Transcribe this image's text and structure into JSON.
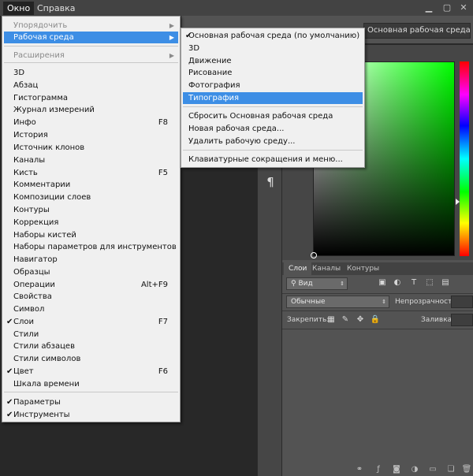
{
  "menubar": {
    "items": [
      "Окно",
      "Справка"
    ]
  },
  "options_bar": {
    "workspace_select": "Основная рабочая среда"
  },
  "dock": {
    "paragraph_glyph": "¶"
  },
  "layers_panel": {
    "tabs": [
      "Слои",
      "Каналы",
      "Контуры"
    ],
    "filter_label": "Вид",
    "blend_mode": "Обычные",
    "opacity_label": "Непрозрачность:",
    "lock_label": "Закрепить:",
    "fill_label": "Заливка:"
  },
  "window_menu": {
    "items": [
      {
        "label": "Упорядочить",
        "submenu": true,
        "disabled": true
      },
      {
        "label": "Рабочая среда",
        "submenu": true,
        "highlighted": true
      },
      {
        "label": "Расширения",
        "submenu": true,
        "disabled": true
      },
      {
        "label": "3D"
      },
      {
        "label": "Абзац"
      },
      {
        "label": "Гистограмма"
      },
      {
        "label": "Журнал измерений"
      },
      {
        "label": "Инфо",
        "shortcut": "F8"
      },
      {
        "label": "История"
      },
      {
        "label": "Источник клонов"
      },
      {
        "label": "Каналы"
      },
      {
        "label": "Кисть",
        "shortcut": "F5"
      },
      {
        "label": "Комментарии"
      },
      {
        "label": "Композиции слоев"
      },
      {
        "label": "Контуры"
      },
      {
        "label": "Коррекция"
      },
      {
        "label": "Наборы кистей"
      },
      {
        "label": "Наборы параметров для инструментов"
      },
      {
        "label": "Навигатор"
      },
      {
        "label": "Образцы"
      },
      {
        "label": "Операции",
        "shortcut": "Alt+F9"
      },
      {
        "label": "Свойства"
      },
      {
        "label": "Символ"
      },
      {
        "label": "Слои",
        "shortcut": "F7",
        "checked": true
      },
      {
        "label": "Стили"
      },
      {
        "label": "Стили абзацев"
      },
      {
        "label": "Стили символов"
      },
      {
        "label": "Цвет",
        "shortcut": "F6",
        "checked": true
      },
      {
        "label": "Шкала времени"
      },
      {
        "label": "Параметры",
        "checked": true
      },
      {
        "label": "Инструменты",
        "checked": true
      }
    ]
  },
  "workspace_submenu": {
    "items": [
      {
        "label": "Основная рабочая среда (по умолчанию)",
        "checked": true
      },
      {
        "label": "3D"
      },
      {
        "label": "Движение"
      },
      {
        "label": "Рисование"
      },
      {
        "label": "Фотография"
      },
      {
        "label": "Типография",
        "highlighted": true
      },
      {
        "label": "Сбросить Основная рабочая среда"
      },
      {
        "label": "Новая рабочая среда..."
      },
      {
        "label": "Удалить рабочую среду..."
      },
      {
        "label": "Клавиатурные сокращения и меню..."
      }
    ]
  },
  "check_glyph": "✔",
  "submenu_arrow": "▶"
}
